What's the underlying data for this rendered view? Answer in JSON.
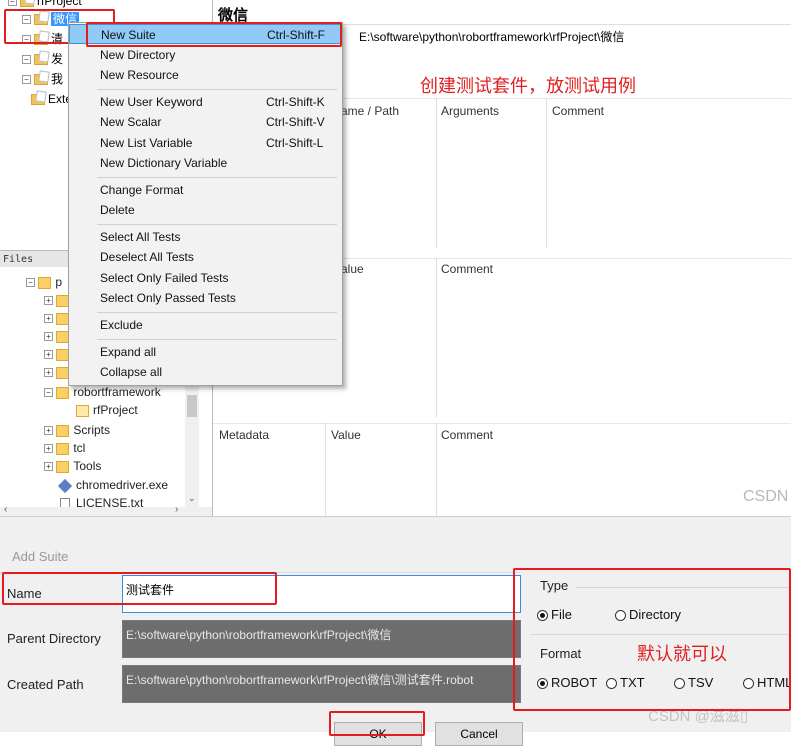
{
  "tree": {
    "root_label": "rfProject",
    "selected_label": "微信",
    "child2_label": "清",
    "child3_label": "发",
    "child4_label": "我",
    "ext_label": "Exte"
  },
  "right_pane": {
    "title": "微信",
    "source_path": "E:\\software\\python\\robortframework\\rfProject\\微信",
    "col_name_path": "ame / Path",
    "col_arguments": "Arguments",
    "col_comment": "Comment",
    "var_value": "alue",
    "var_comment": "Comment",
    "meta_metadata": "Metadata",
    "meta_value": "Value",
    "meta_comment": "Comment"
  },
  "annotation_top": "创建测试套件，放测试用例",
  "files": {
    "header": "Files",
    "items": [
      {
        "label": "p"
      },
      {
        "label": ""
      },
      {
        "label": ""
      },
      {
        "label": ""
      },
      {
        "label": ""
      },
      {
        "label": ""
      },
      {
        "label": "robortframework"
      },
      {
        "label": "rfProject"
      },
      {
        "label": "Scripts"
      },
      {
        "label": "tcl"
      },
      {
        "label": "Tools"
      },
      {
        "label": "chromedriver.exe"
      },
      {
        "label": "LICENSE.txt"
      }
    ]
  },
  "context_menu": {
    "items": [
      {
        "label": "New Suite",
        "shortcut": "Ctrl-Shift-F"
      },
      {
        "label": "New Directory",
        "shortcut": ""
      },
      {
        "label": "New Resource",
        "shortcut": ""
      },
      {
        "label": "New User Keyword",
        "shortcut": "Ctrl-Shift-K"
      },
      {
        "label": "New Scalar",
        "shortcut": "Ctrl-Shift-V"
      },
      {
        "label": "New List Variable",
        "shortcut": "Ctrl-Shift-L"
      },
      {
        "label": "New Dictionary Variable",
        "shortcut": ""
      },
      {
        "label": "Change Format",
        "shortcut": ""
      },
      {
        "label": "Delete",
        "shortcut": ""
      },
      {
        "label": "Select All Tests",
        "shortcut": ""
      },
      {
        "label": "Deselect All Tests",
        "shortcut": ""
      },
      {
        "label": "Select Only Failed Tests",
        "shortcut": ""
      },
      {
        "label": "Select Only Passed Tests",
        "shortcut": ""
      },
      {
        "label": "Exclude",
        "shortcut": ""
      },
      {
        "label": "Expand all",
        "shortcut": ""
      },
      {
        "label": "Collapse all",
        "shortcut": ""
      }
    ]
  },
  "watermark_top": "CSDN",
  "dialog": {
    "title": "Add Suite",
    "name_label": "Name",
    "name_value": "测试套件",
    "parent_label": "Parent Directory",
    "parent_value": "E:\\software\\python\\robortframework\\rfProject\\微信",
    "created_label": "Created Path",
    "created_value": "E:\\software\\python\\robortframework\\rfProject\\微信\\测试套件.robot",
    "type_label": "Type",
    "type_file": "File",
    "type_directory": "Directory",
    "format_label": "Format",
    "format_robot": "ROBOT",
    "format_txt": "TXT",
    "format_tsv": "TSV",
    "format_html": "HTML",
    "annotation": "默认就可以",
    "ok_label": "OK",
    "cancel_label": "Cancel",
    "watermark": "CSDN @滋滋▯"
  }
}
